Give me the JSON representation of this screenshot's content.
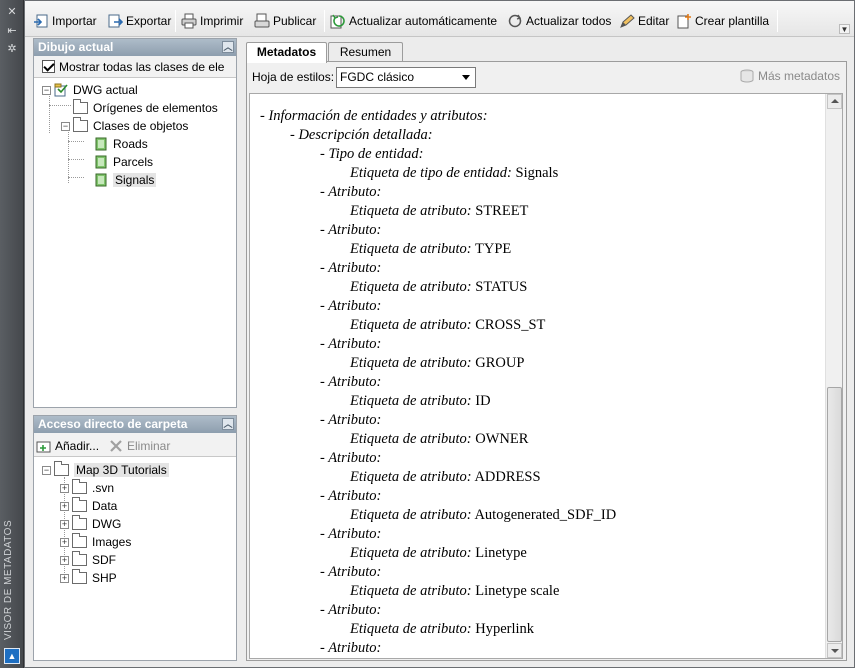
{
  "side_strip": {
    "title": "VISOR DE METADATOS"
  },
  "toolbar": {
    "import": "Importar",
    "export": "Exportar",
    "print": "Imprimir",
    "publish": "Publicar",
    "auto_update": "Actualizar automáticamente",
    "update_all": "Actualizar todos",
    "edit": "Editar",
    "create_template": "Crear plantilla"
  },
  "current_drawing": {
    "title": "Dibujo actual",
    "show_all_checkbox": "Mostrar todas las clases de ele",
    "tree": {
      "root": "DWG actual",
      "sources": "Orígenes de elementos",
      "classes": "Clases de objetos",
      "layers": [
        "Roads",
        "Parcels",
        "Signals"
      ]
    }
  },
  "folder_shortcut": {
    "title": "Acceso directo de carpeta",
    "add_label": "Añadir...",
    "remove_label": "Eliminar",
    "root": "Map 3D Tutorials",
    "children": [
      ".svn",
      "Data",
      "DWG",
      "Images",
      "SDF",
      "SHP"
    ]
  },
  "tabs": {
    "metadata": "Metadatos",
    "summary": "Resumen"
  },
  "stylesheet": {
    "label": "Hoja de estilos:",
    "selected": "FGDC clásico",
    "more_metadata": "Más metadatos"
  },
  "document": {
    "entity_info": "- Información de entidades y atributos:",
    "detailed_desc": "- Descripción detallada:",
    "entity_type": "- Tipo de entidad:",
    "entity_type_label": "Etiqueta de tipo de entidad:",
    "entity_type_value": "Signals",
    "attribute_heading": "- Atributo:",
    "attribute_label": "Etiqueta de atributo:",
    "attributes": [
      "STREET",
      "TYPE",
      "STATUS",
      "CROSS_ST",
      "GROUP",
      "ID",
      "OWNER",
      "ADDRESS",
      "Autogenerated_SDF_ID",
      "Linetype",
      "Linetype scale",
      "Hyperlink"
    ]
  }
}
